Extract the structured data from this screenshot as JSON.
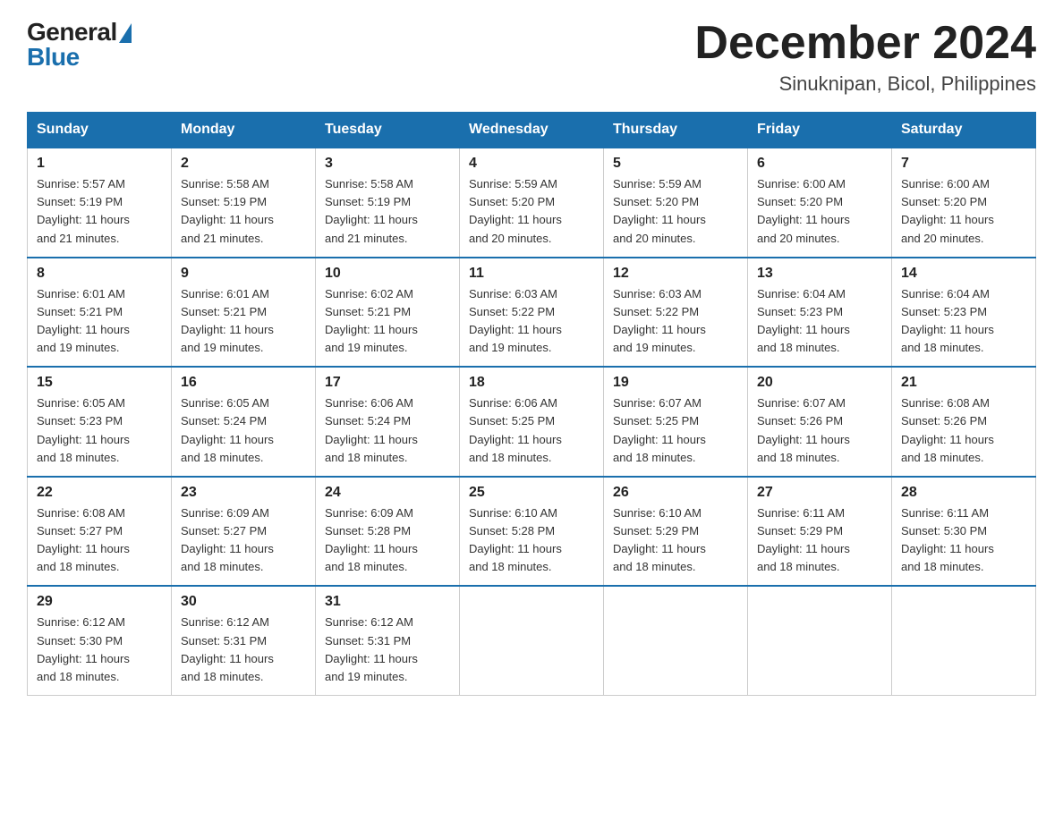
{
  "logo": {
    "general": "General",
    "blue": "Blue"
  },
  "title": {
    "month": "December 2024",
    "location": "Sinuknipan, Bicol, Philippines"
  },
  "weekdays": [
    "Sunday",
    "Monday",
    "Tuesday",
    "Wednesday",
    "Thursday",
    "Friday",
    "Saturday"
  ],
  "weeks": [
    [
      {
        "day": "1",
        "sunrise": "5:57 AM",
        "sunset": "5:19 PM",
        "daylight": "11 hours and 21 minutes."
      },
      {
        "day": "2",
        "sunrise": "5:58 AM",
        "sunset": "5:19 PM",
        "daylight": "11 hours and 21 minutes."
      },
      {
        "day": "3",
        "sunrise": "5:58 AM",
        "sunset": "5:19 PM",
        "daylight": "11 hours and 21 minutes."
      },
      {
        "day": "4",
        "sunrise": "5:59 AM",
        "sunset": "5:20 PM",
        "daylight": "11 hours and 20 minutes."
      },
      {
        "day": "5",
        "sunrise": "5:59 AM",
        "sunset": "5:20 PM",
        "daylight": "11 hours and 20 minutes."
      },
      {
        "day": "6",
        "sunrise": "6:00 AM",
        "sunset": "5:20 PM",
        "daylight": "11 hours and 20 minutes."
      },
      {
        "day": "7",
        "sunrise": "6:00 AM",
        "sunset": "5:20 PM",
        "daylight": "11 hours and 20 minutes."
      }
    ],
    [
      {
        "day": "8",
        "sunrise": "6:01 AM",
        "sunset": "5:21 PM",
        "daylight": "11 hours and 19 minutes."
      },
      {
        "day": "9",
        "sunrise": "6:01 AM",
        "sunset": "5:21 PM",
        "daylight": "11 hours and 19 minutes."
      },
      {
        "day": "10",
        "sunrise": "6:02 AM",
        "sunset": "5:21 PM",
        "daylight": "11 hours and 19 minutes."
      },
      {
        "day": "11",
        "sunrise": "6:03 AM",
        "sunset": "5:22 PM",
        "daylight": "11 hours and 19 minutes."
      },
      {
        "day": "12",
        "sunrise": "6:03 AM",
        "sunset": "5:22 PM",
        "daylight": "11 hours and 19 minutes."
      },
      {
        "day": "13",
        "sunrise": "6:04 AM",
        "sunset": "5:23 PM",
        "daylight": "11 hours and 18 minutes."
      },
      {
        "day": "14",
        "sunrise": "6:04 AM",
        "sunset": "5:23 PM",
        "daylight": "11 hours and 18 minutes."
      }
    ],
    [
      {
        "day": "15",
        "sunrise": "6:05 AM",
        "sunset": "5:23 PM",
        "daylight": "11 hours and 18 minutes."
      },
      {
        "day": "16",
        "sunrise": "6:05 AM",
        "sunset": "5:24 PM",
        "daylight": "11 hours and 18 minutes."
      },
      {
        "day": "17",
        "sunrise": "6:06 AM",
        "sunset": "5:24 PM",
        "daylight": "11 hours and 18 minutes."
      },
      {
        "day": "18",
        "sunrise": "6:06 AM",
        "sunset": "5:25 PM",
        "daylight": "11 hours and 18 minutes."
      },
      {
        "day": "19",
        "sunrise": "6:07 AM",
        "sunset": "5:25 PM",
        "daylight": "11 hours and 18 minutes."
      },
      {
        "day": "20",
        "sunrise": "6:07 AM",
        "sunset": "5:26 PM",
        "daylight": "11 hours and 18 minutes."
      },
      {
        "day": "21",
        "sunrise": "6:08 AM",
        "sunset": "5:26 PM",
        "daylight": "11 hours and 18 minutes."
      }
    ],
    [
      {
        "day": "22",
        "sunrise": "6:08 AM",
        "sunset": "5:27 PM",
        "daylight": "11 hours and 18 minutes."
      },
      {
        "day": "23",
        "sunrise": "6:09 AM",
        "sunset": "5:27 PM",
        "daylight": "11 hours and 18 minutes."
      },
      {
        "day": "24",
        "sunrise": "6:09 AM",
        "sunset": "5:28 PM",
        "daylight": "11 hours and 18 minutes."
      },
      {
        "day": "25",
        "sunrise": "6:10 AM",
        "sunset": "5:28 PM",
        "daylight": "11 hours and 18 minutes."
      },
      {
        "day": "26",
        "sunrise": "6:10 AM",
        "sunset": "5:29 PM",
        "daylight": "11 hours and 18 minutes."
      },
      {
        "day": "27",
        "sunrise": "6:11 AM",
        "sunset": "5:29 PM",
        "daylight": "11 hours and 18 minutes."
      },
      {
        "day": "28",
        "sunrise": "6:11 AM",
        "sunset": "5:30 PM",
        "daylight": "11 hours and 18 minutes."
      }
    ],
    [
      {
        "day": "29",
        "sunrise": "6:12 AM",
        "sunset": "5:30 PM",
        "daylight": "11 hours and 18 minutes."
      },
      {
        "day": "30",
        "sunrise": "6:12 AM",
        "sunset": "5:31 PM",
        "daylight": "11 hours and 18 minutes."
      },
      {
        "day": "31",
        "sunrise": "6:12 AM",
        "sunset": "5:31 PM",
        "daylight": "11 hours and 19 minutes."
      },
      null,
      null,
      null,
      null
    ]
  ]
}
